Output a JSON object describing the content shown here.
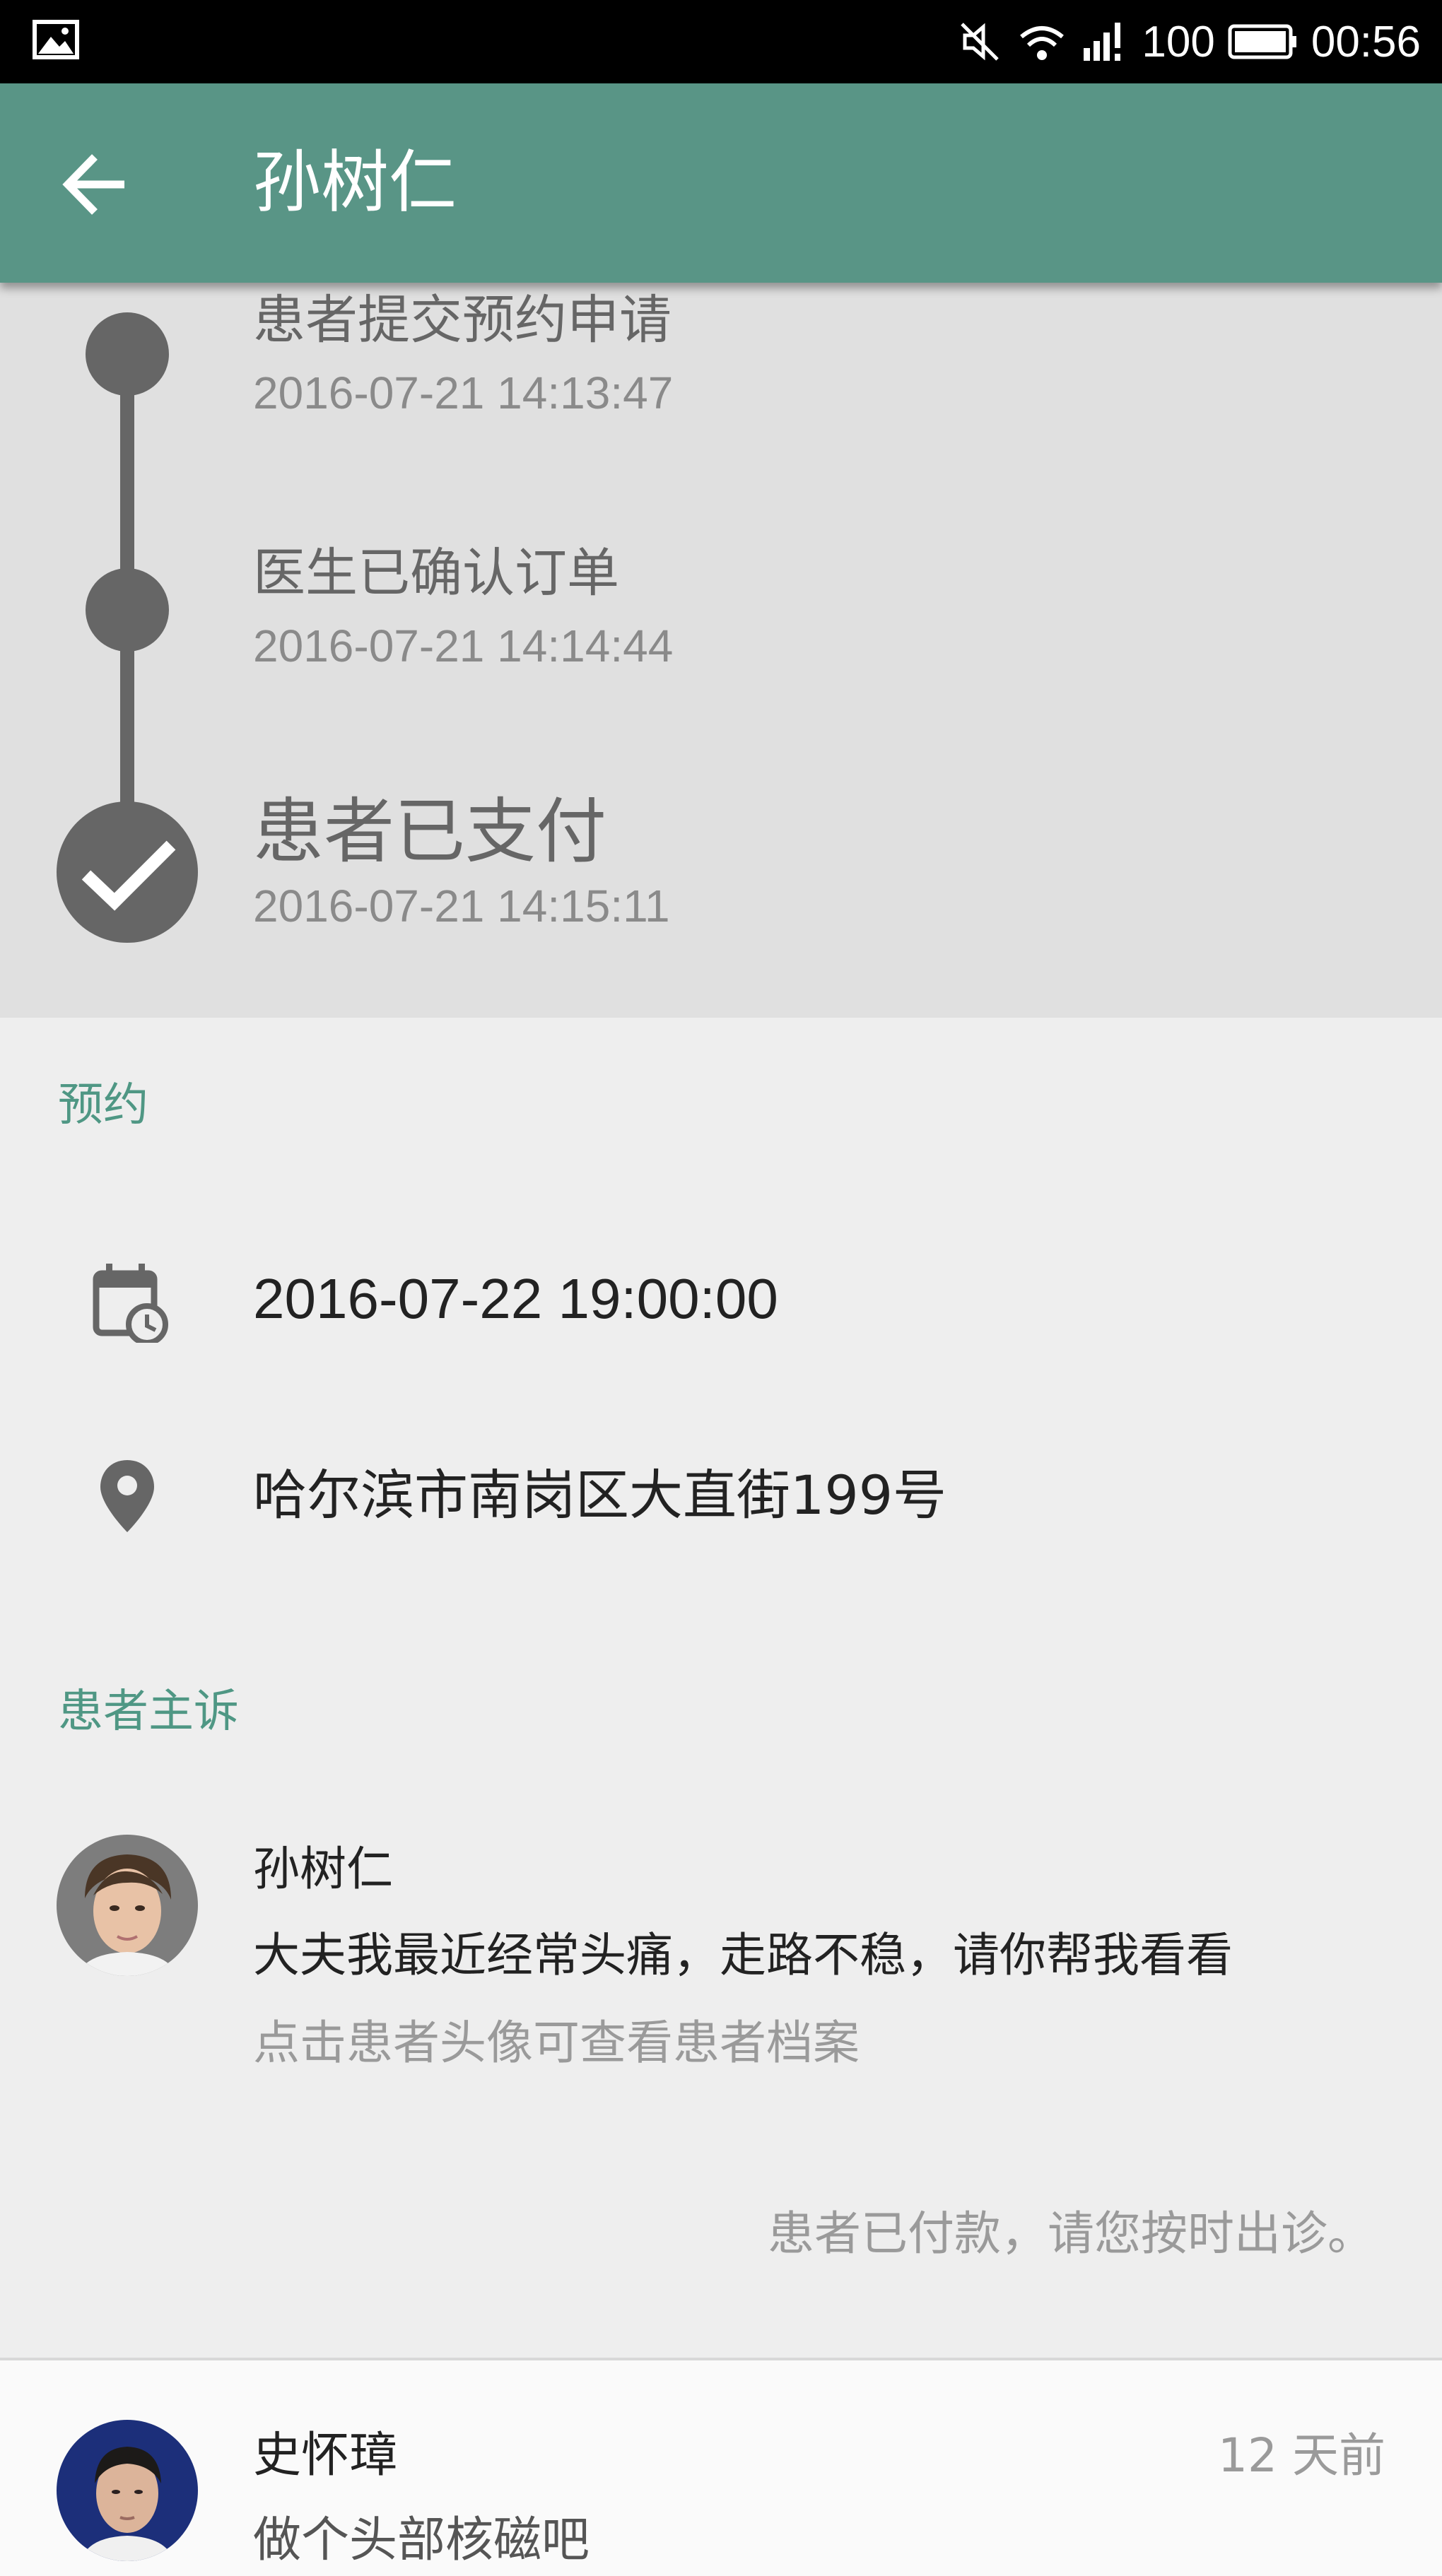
{
  "status_bar": {
    "battery": "100",
    "time": "00:56"
  },
  "toolbar": {
    "title": "孙树仁"
  },
  "timeline": [
    {
      "title": "患者提交预约申请",
      "time": "2016-07-21 14:13:47"
    },
    {
      "title": "医生已确认订单",
      "time": "2016-07-21 14:14:44"
    },
    {
      "title": "患者已支付",
      "time": "2016-07-21 14:15:11"
    }
  ],
  "appointment": {
    "section_label": "预约",
    "datetime": "2016-07-22 19:00:00",
    "address": "哈尔滨市南岗区大直街199号"
  },
  "complaint": {
    "section_label": "患者主诉",
    "patient_name": "孙树仁",
    "message": "大夫我最近经常头痛，走路不稳，请你帮我看看",
    "hint": "点击患者头像可查看患者档案",
    "paid_note": "患者已付款，请您按时出诊。"
  },
  "message_card": {
    "sender": "史怀璋",
    "time": "12 天前",
    "text": "做个头部核磁吧"
  },
  "colors": {
    "toolbar": "#599586",
    "accent": "#4f9784",
    "timeline_bg": "#e0e0e0",
    "timeline_mark": "#666666"
  }
}
